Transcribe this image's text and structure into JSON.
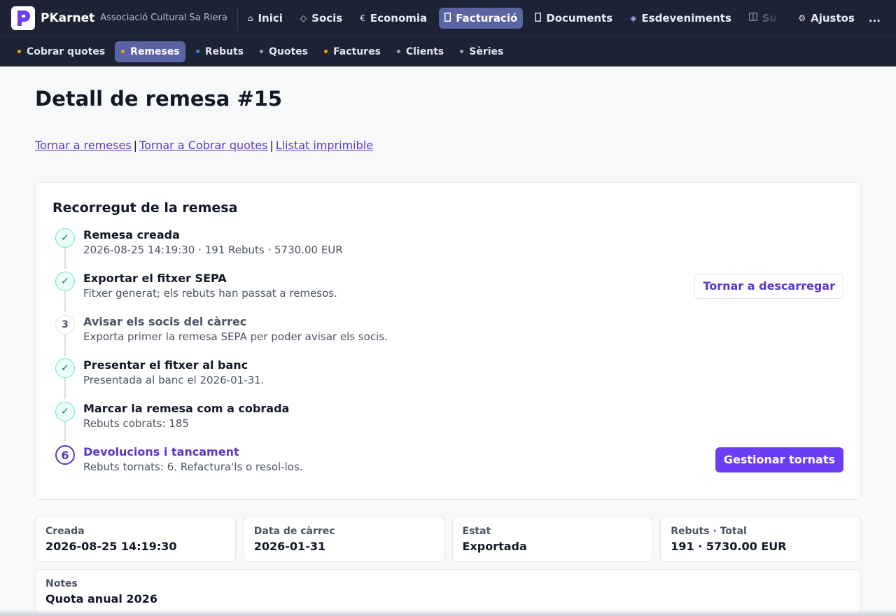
{
  "brand": {
    "name": "PKarnet",
    "org": "Associació Cultural Sa Riera",
    "accent": "#6d3df5"
  },
  "nav": {
    "items": [
      {
        "icon": "⌂",
        "icon_name": "home-icon",
        "label": "Inici"
      },
      {
        "icon": "◇",
        "icon_name": "diamond-icon",
        "label": "Socis"
      },
      {
        "icon": "€",
        "icon_name": "euro-icon",
        "label": "Economia"
      },
      {
        "icon": "",
        "icon_name": "invoice-icon",
        "label": "Facturació",
        "active": true
      },
      {
        "icon": "",
        "icon_name": "document-icon",
        "label": "Documents"
      },
      {
        "icon": "◈",
        "icon_name": "event-icon",
        "label": "Esdeveniments"
      },
      {
        "icon": "",
        "icon_name": "subscription-icon",
        "label": "Su"
      }
    ],
    "settings": {
      "icon": "⚙",
      "icon_name": "gear-icon",
      "label": "Ajustos"
    },
    "more": "..."
  },
  "subnav": {
    "items": [
      {
        "label": "Cobrar quotes",
        "dot_color": "#f59e0b"
      },
      {
        "label": "Remeses",
        "dot_color": "#f59e0b",
        "active": true
      },
      {
        "label": "Rebuts",
        "dot_color": "#3b82f6"
      },
      {
        "label": "Quotes",
        "dot_color": "#9ca3af"
      },
      {
        "label": "Factures",
        "dot_color": "#f59e0b"
      },
      {
        "label": "Clients",
        "dot_color": "#9ca3af"
      },
      {
        "label": "Sèries",
        "dot_color": "#9ca3af"
      }
    ]
  },
  "page": {
    "title": "Detall de remesa #15",
    "links": [
      "Tornar a remeses",
      "Tornar a Cobrar quotes",
      "Llistat imprimible"
    ],
    "separator": "|"
  },
  "journey": {
    "title": "Recorregut de la remesa",
    "steps": [
      {
        "marker": "✓",
        "state": "done",
        "title": "Remesa creada",
        "desc": "2026-08-25 14:19:30 · 191 Rebuts · 5730.00 EUR"
      },
      {
        "marker": "✓",
        "state": "done",
        "title": "Exportar el fitxer SEPA",
        "desc": "Fitxer generat; els rebuts han passat a remesos.",
        "action": "Tornar a descarregar"
      },
      {
        "marker": "3",
        "state": "pending",
        "title": "Avisar els socis del càrrec",
        "desc": "Exporta primer la remesa SEPA per poder avisar els socis."
      },
      {
        "marker": "✓",
        "state": "done",
        "title": "Presentar el fitxer al banc",
        "desc": "Presentada al banc el 2026-01-31."
      },
      {
        "marker": "✓",
        "state": "done",
        "title": "Marcar la remesa com a cobrada",
        "desc": "Rebuts cobrats: 185"
      },
      {
        "marker": "6",
        "state": "current",
        "title": "Devolucions i tancament",
        "desc": "Rebuts tornats: 6. Refactura'ls o resol-los.",
        "action": "Gestionar tornats"
      }
    ]
  },
  "stats": [
    {
      "label": "Creada",
      "value": "2026-08-25 14:19:30"
    },
    {
      "label": "Data de càrrec",
      "value": "2026-01-31"
    },
    {
      "label": "Estat",
      "value": "Exportada"
    },
    {
      "label": "Rebuts · Total",
      "value": "191 · 5730.00 EUR"
    }
  ],
  "notes": {
    "label": "Notes",
    "value": "Quota anual 2026"
  }
}
